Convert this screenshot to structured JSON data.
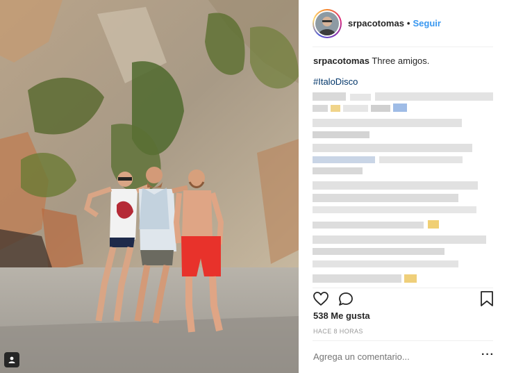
{
  "header": {
    "username": "srpacotomas",
    "separator": "•",
    "follow_label": "Seguir"
  },
  "caption": {
    "username": "srpacotomas",
    "text": "Three amigos.",
    "hashtag": "#ItaloDisco"
  },
  "engagement": {
    "likes": "538 Me gusta",
    "timestamp": "HACE 8 HORAS"
  },
  "comment": {
    "placeholder": "Agrega un comentario...",
    "more_label": "···"
  },
  "icons": {
    "like": "heart-icon",
    "comment": "comment-bubble-icon",
    "save": "bookmark-icon",
    "tagged": "person-tag-icon"
  },
  "colors": {
    "link": "#3897f0",
    "hashtag": "#003569",
    "meta": "#999999",
    "text": "#262626"
  }
}
